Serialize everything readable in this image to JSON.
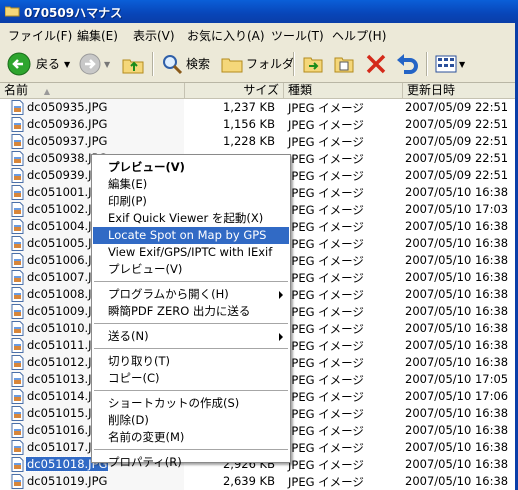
{
  "window": {
    "title": "070509ハマナス"
  },
  "menubar": {
    "items": [
      "ファイル(F)",
      "編集(E)",
      "表示(V)",
      "お気に入り(A)",
      "ツール(T)",
      "ヘルプ(H)"
    ]
  },
  "toolbar": {
    "back_label": "戻る",
    "search_label": "検索",
    "folders_label": "フォルダ"
  },
  "columns": {
    "name": "名前",
    "size": "サイズ",
    "type": "種類",
    "date": "更新日時"
  },
  "files": [
    {
      "name": "dc050935.JPG",
      "size": "1,237 KB",
      "type": "JPEG イメージ",
      "date": "2007/05/09 22:51"
    },
    {
      "name": "dc050936.JPG",
      "size": "1,156 KB",
      "type": "JPEG イメージ",
      "date": "2007/05/09 22:51"
    },
    {
      "name": "dc050937.JPG",
      "size": "1,228 KB",
      "type": "JPEG イメージ",
      "date": "2007/05/09 22:51"
    },
    {
      "name": "dc050938.JPG",
      "size": "",
      "type": "JPEG イメージ",
      "date": "2007/05/09 22:51"
    },
    {
      "name": "dc050939.JPG",
      "size": "",
      "type": "JPEG イメージ",
      "date": "2007/05/09 22:51"
    },
    {
      "name": "dc051001.JPG",
      "size": "",
      "type": "JPEG イメージ",
      "date": "2007/05/10 16:38"
    },
    {
      "name": "dc051002.JPG",
      "size": "",
      "type": "JPEG イメージ",
      "date": "2007/05/10 17:03"
    },
    {
      "name": "dc051004.JPG",
      "size": "",
      "type": "JPEG イメージ",
      "date": "2007/05/10 16:38"
    },
    {
      "name": "dc051005.JPG",
      "size": "",
      "type": "JPEG イメージ",
      "date": "2007/05/10 16:38"
    },
    {
      "name": "dc051006.JPG",
      "size": "",
      "type": "JPEG イメージ",
      "date": "2007/05/10 16:38"
    },
    {
      "name": "dc051007.JPG",
      "size": "",
      "type": "JPEG イメージ",
      "date": "2007/05/10 16:38"
    },
    {
      "name": "dc051008.JPG",
      "size": "",
      "type": "JPEG イメージ",
      "date": "2007/05/10 16:38"
    },
    {
      "name": "dc051009.JPG",
      "size": "",
      "type": "JPEG イメージ",
      "date": "2007/05/10 16:38"
    },
    {
      "name": "dc051010.JPG",
      "size": "",
      "type": "JPEG イメージ",
      "date": "2007/05/10 16:38"
    },
    {
      "name": "dc051011.JPG",
      "size": "",
      "type": "JPEG イメージ",
      "date": "2007/05/10 16:38"
    },
    {
      "name": "dc051012.JPG",
      "size": "",
      "type": "JPEG イメージ",
      "date": "2007/05/10 16:38"
    },
    {
      "name": "dc051013.JPG",
      "size": "",
      "type": "JPEG イメージ",
      "date": "2007/05/10 17:05"
    },
    {
      "name": "dc051014.JPG",
      "size": "",
      "type": "JPEG イメージ",
      "date": "2007/05/10 17:06"
    },
    {
      "name": "dc051015.JPG",
      "size": "",
      "type": "JPEG イメージ",
      "date": "2007/05/10 16:38"
    },
    {
      "name": "dc051016.JPG",
      "size": "",
      "type": "JPEG イメージ",
      "date": "2007/05/10 16:38"
    },
    {
      "name": "dc051017.JPG",
      "size": "",
      "type": "JPEG イメージ",
      "date": "2007/05/10 16:38"
    },
    {
      "name": "dc051018.JPG",
      "size": "2,926 KB",
      "type": "JPEG イメージ",
      "date": "2007/05/10 16:38"
    },
    {
      "name": "dc051019.JPG",
      "size": "2,639 KB",
      "type": "JPEG イメージ",
      "date": "2007/05/10 16:38"
    }
  ],
  "selected_file_index": 21,
  "context_menu": {
    "items": [
      {
        "label": "プレビュー(V)",
        "bold": true
      },
      {
        "label": "編集(E)"
      },
      {
        "label": "印刷(P)"
      },
      {
        "label": "Exif Quick Viewer を起動(X)"
      },
      {
        "label": "Locate Spot on Map by GPS",
        "highlight": true
      },
      {
        "label": "View Exif/GPS/IPTC with IExif"
      },
      {
        "label": "プレビュー(V)"
      },
      {
        "sep": true
      },
      {
        "label": "プログラムから開く(H)",
        "submenu": true
      },
      {
        "label": "瞬簡PDF ZERO 出力に送る"
      },
      {
        "sep": true
      },
      {
        "label": "送る(N)",
        "submenu": true
      },
      {
        "sep": true
      },
      {
        "label": "切り取り(T)"
      },
      {
        "label": "コピー(C)"
      },
      {
        "sep": true
      },
      {
        "label": "ショートカットの作成(S)"
      },
      {
        "label": "削除(D)"
      },
      {
        "label": "名前の変更(M)"
      },
      {
        "sep": true
      },
      {
        "label": "プロパティ(R)"
      }
    ]
  },
  "colors": {
    "titlebar": "#0845b8",
    "selection": "#316ac5",
    "toolbar": "#ece9d8"
  }
}
